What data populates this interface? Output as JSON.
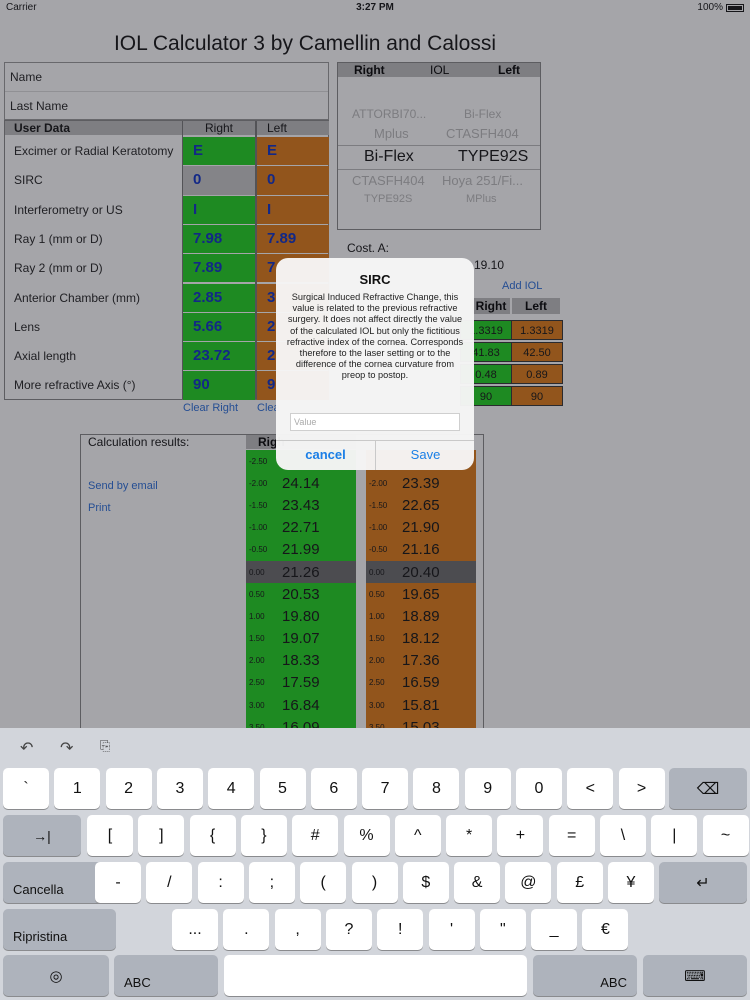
{
  "status_bar": {
    "carrier": "Carrier",
    "time": "3:27 PM",
    "battery": "100%"
  },
  "app": {
    "title": "IOL Calculator 3 by Camellin and Calossi",
    "name_fields": [
      "Name",
      "Last Name"
    ],
    "user_data": {
      "header": "User Data",
      "col_right": "Right",
      "col_left": "Left",
      "rows": [
        {
          "label": "Excimer or Radial Keratotomy",
          "right": "E",
          "left": "E"
        },
        {
          "label": "SIRC",
          "right": "0",
          "left": "0"
        },
        {
          "label": "Interferometry or US",
          "right": "I",
          "left": "I"
        },
        {
          "label": "Ray 1 (mm or D)",
          "right": "7.98",
          "left": "7.89"
        },
        {
          "label": "Ray 2 (mm or D)",
          "right": "7.89",
          "left": "7"
        },
        {
          "label": "Anterior Chamber (mm)",
          "right": "2.85",
          "left": "3"
        },
        {
          "label": "Lens",
          "right": "5.66",
          "left": "2"
        },
        {
          "label": "Axial length",
          "right": "23.72",
          "left": "2"
        },
        {
          "label": "More refractive Axis (°)",
          "right": "90",
          "left": "9"
        }
      ],
      "clear_right": "Clear Right",
      "clear_left": "Clea"
    },
    "iol_picker": {
      "col_right": "Right",
      "col_iol": "IOL",
      "col_left": "Left",
      "rows": [
        {
          "right": "",
          "left": ""
        },
        {
          "right": "ATTORBI70...",
          "left": "Bi-Flex"
        },
        {
          "right": "Mplus",
          "left": "CTASFH404"
        },
        {
          "right": "Bi-Flex",
          "left": "TYPE92S"
        },
        {
          "right": "CTASFH404",
          "left": "Hoya 251/Fi..."
        },
        {
          "right": "TYPE92S",
          "left": "MPlus"
        }
      ]
    },
    "cost_label": "Cost. A:",
    "cost_value": "19.10",
    "add_iol": "Add IOL",
    "small_table": {
      "col_right": "Right",
      "col_left": "Left",
      "rows": [
        {
          "right": "1.3319",
          "left": "1.3319"
        },
        {
          "right": "41.83",
          "left": "42.50"
        },
        {
          "right": "0.48",
          "left": "0.89"
        },
        {
          "right": "90",
          "left": "90"
        }
      ]
    },
    "results": {
      "label": "Calculation results:",
      "col_right": "Righ",
      "send_email": "Send by email",
      "print": "Print",
      "right_rows": [
        {
          "k": "-2.50",
          "v": ""
        },
        {
          "k": "-2.00",
          "v": "24.14"
        },
        {
          "k": "-1.50",
          "v": "23.43"
        },
        {
          "k": "-1.00",
          "v": "22.71"
        },
        {
          "k": "-0.50",
          "v": "21.99"
        },
        {
          "k": "0.00",
          "v": "21.26"
        },
        {
          "k": "0.50",
          "v": "20.53"
        },
        {
          "k": "1.00",
          "v": "19.80"
        },
        {
          "k": "1.50",
          "v": "19.07"
        },
        {
          "k": "2.00",
          "v": "18.33"
        },
        {
          "k": "2.50",
          "v": "17.59"
        },
        {
          "k": "3.00",
          "v": "16.84"
        },
        {
          "k": "3.50",
          "v": "16.09"
        }
      ],
      "left_rows": [
        {
          "k": "",
          "v": ""
        },
        {
          "k": "-2.00",
          "v": "23.39"
        },
        {
          "k": "-1.50",
          "v": "22.65"
        },
        {
          "k": "-1.00",
          "v": "21.90"
        },
        {
          "k": "-0.50",
          "v": "21.16"
        },
        {
          "k": "0.00",
          "v": "20.40"
        },
        {
          "k": "0.50",
          "v": "19.65"
        },
        {
          "k": "1.00",
          "v": "18.89"
        },
        {
          "k": "1.50",
          "v": "18.12"
        },
        {
          "k": "2.00",
          "v": "17.36"
        },
        {
          "k": "2.50",
          "v": "16.59"
        },
        {
          "k": "3.00",
          "v": "15.81"
        },
        {
          "k": "3.50",
          "v": "15.03"
        }
      ]
    }
  },
  "dialog": {
    "title": "SIRC",
    "message": "Surgical Induced Refractive Change, this value is related to the previous refractive surgery. It does not affect directly the value of the calculated IOL but only the fictitious refractive index of the cornea. Corresponds therefore to the laser setting or to the difference of the cornea curvature from preop to postop.",
    "input_placeholder": "Value",
    "input_value": "",
    "cancel": "cancel",
    "save": "Save"
  },
  "keyboard": {
    "toolbar": {
      "undo_icon": "undo-icon",
      "redo_icon": "redo-icon",
      "paste_icon": "paste-icon"
    },
    "row1": [
      "`",
      "1",
      "2",
      "3",
      "4",
      "5",
      "6",
      "7",
      "8",
      "9",
      "0",
      "<",
      ">"
    ],
    "row2": [
      "[",
      "]",
      "{",
      "}",
      "#",
      "%",
      "^",
      "*",
      "+",
      "=",
      "\\",
      "|",
      "~"
    ],
    "row3": [
      "-",
      "/",
      ":",
      ";",
      "(",
      ")",
      "$",
      "&",
      "@",
      "£",
      "¥"
    ],
    "row4": [
      "...",
      ".",
      ",",
      "?",
      "!",
      "'",
      "\"",
      "_",
      "€"
    ],
    "tab_symbol": "→|",
    "cancel": "Cancella",
    "reset": "Ripristina",
    "abc_left": "ABC",
    "abc_right": "ABC",
    "globe_icon": "globe-icon",
    "backspace_icon": "backspace-icon",
    "return_icon": "return-icon",
    "hide_keyboard_icon": "keyboard-hide-icon"
  }
}
